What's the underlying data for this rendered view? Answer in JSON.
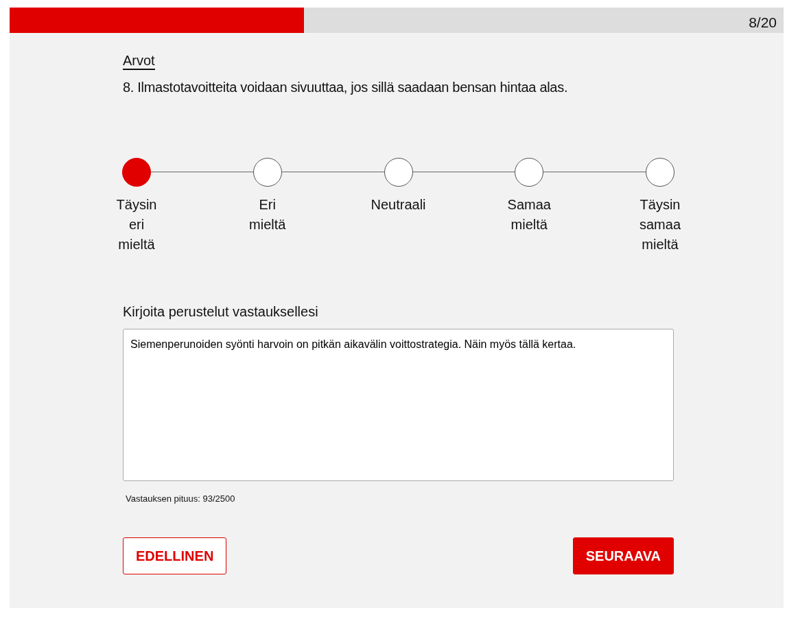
{
  "progress": {
    "level": 0.38,
    "counter": "8/20"
  },
  "category": "Arvot",
  "question": "8. Ilmastotavoitteita voidaan sivuuttaa, jos sillä saadaan bensan hintaa alas.",
  "scale": [
    {
      "label": "Täysin eri mieltä",
      "selected": true
    },
    {
      "label": "Eri mieltä",
      "selected": false
    },
    {
      "label": "Neutraali",
      "selected": false
    },
    {
      "label": "Samaa mieltä",
      "selected": false
    },
    {
      "label": "Täysin samaa mieltä",
      "selected": false
    }
  ],
  "answer": {
    "label": "Kirjoita perustelut vastauksellesi",
    "value": "Siemenperunoiden syönti harvoin on pitkän aikavälin voittostrategia. Näin myös tällä kertaa.",
    "length": "Vastauksen pituus: 93/2500"
  },
  "buttons": {
    "previous": "EDELLINEN",
    "next": "SEURAAVA"
  }
}
